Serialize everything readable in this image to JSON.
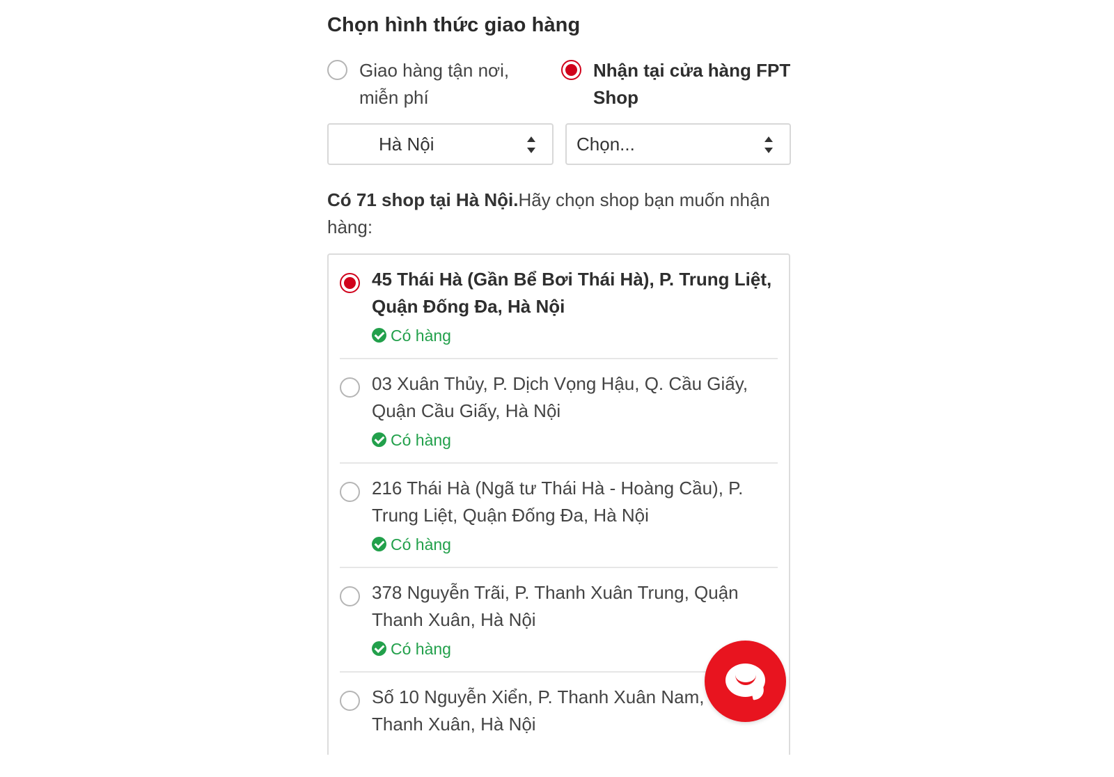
{
  "delivery": {
    "title": "Chọn hình thức giao hàng",
    "options": [
      {
        "label": "Giao hàng tận nơi, miễn phí",
        "selected": false
      },
      {
        "label": "Nhận tại cửa hàng FPT Shop",
        "selected": true
      }
    ]
  },
  "filters": {
    "province": "Hà Nội",
    "district": "Chọn..."
  },
  "shop_count": {
    "bold_text": "Có 71 shop tại Hà Nội.",
    "text": "Hãy chọn shop bạn muốn nhận hàng:"
  },
  "stores": [
    {
      "address": "45 Thái Hà (Gần Bể Bơi Thái Hà), P. Trung Liệt, Quận Đống Đa, Hà Nội",
      "stock": "Có hàng",
      "selected": true
    },
    {
      "address": "03 Xuân Thủy, P. Dịch Vọng Hậu, Q. Cầu Giấy, Quận Cầu Giấy, Hà Nội",
      "stock": "Có hàng",
      "selected": false
    },
    {
      "address": "216 Thái Hà (Ngã tư Thái Hà - Hoàng Cầu), P. Trung Liệt, Quận Đống Đa, Hà Nội",
      "stock": "Có hàng",
      "selected": false
    },
    {
      "address": "378 Nguyễn Trãi, P. Thanh Xuân Trung, Quận Thanh Xuân, Hà Nội",
      "stock": "Có hàng",
      "selected": false
    },
    {
      "address": "Số 10 Nguyễn Xiển, P. Thanh Xuân Nam, Q. Thanh Xuân, Hà Nội",
      "stock": "",
      "selected": false
    }
  ],
  "colors": {
    "accent": "#d0021b",
    "in_stock": "#22a04b",
    "chat_button": "#e8141f"
  },
  "icons": {
    "chat": "chat-bubble-icon",
    "stock": "check-circle-icon",
    "select": "sort-arrows-icon"
  }
}
